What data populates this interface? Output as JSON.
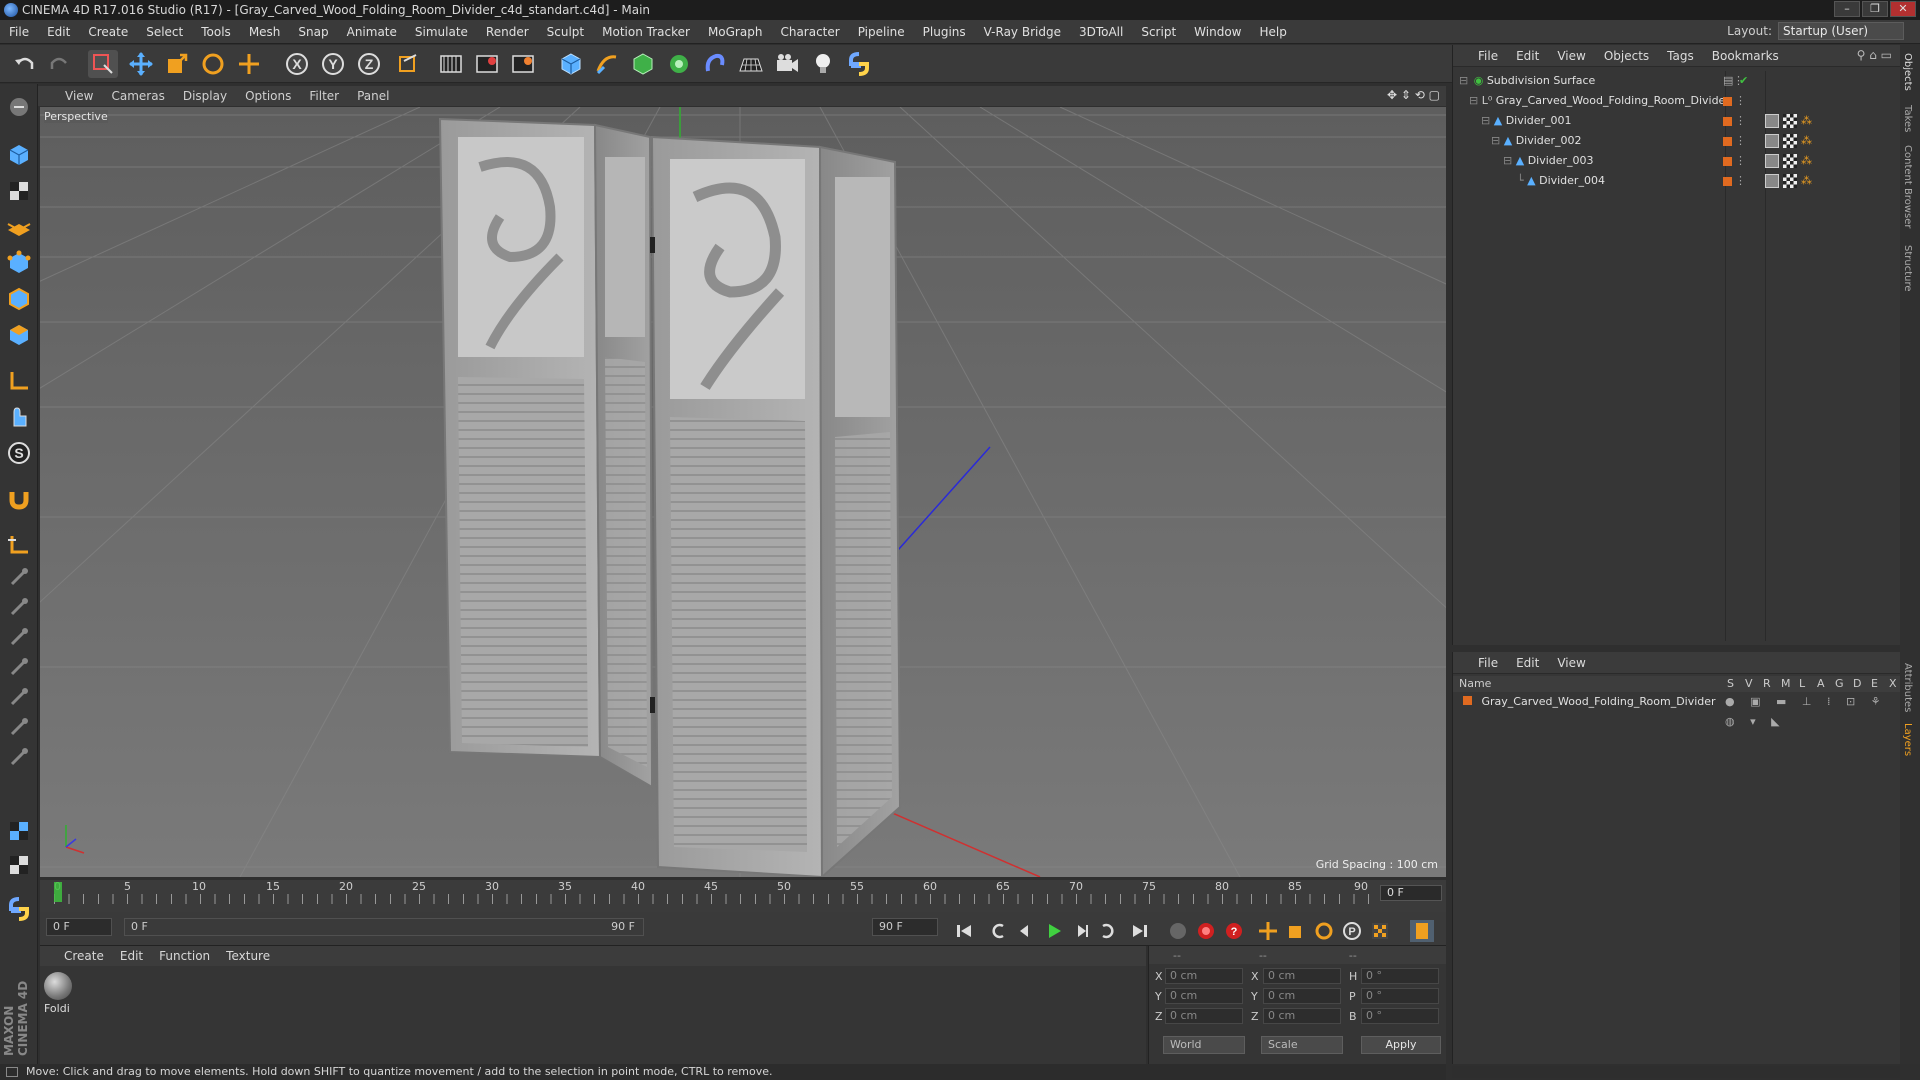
{
  "window": {
    "title": "CINEMA 4D R17.016 Studio (R17) - [Gray_Carved_Wood_Folding_Room_Divider_c4d_standart.c4d] - Main"
  },
  "menu": [
    "File",
    "Edit",
    "Create",
    "Select",
    "Tools",
    "Mesh",
    "Snap",
    "Animate",
    "Simulate",
    "Render",
    "Sculpt",
    "Motion Tracker",
    "MoGraph",
    "Character",
    "Pipeline",
    "Plugins",
    "V-Ray Bridge",
    "3DToAll",
    "Script",
    "Window",
    "Help"
  ],
  "layout": {
    "label": "Layout:",
    "value": "Startup (User)"
  },
  "viewport": {
    "menu": [
      "View",
      "Cameras",
      "Display",
      "Options",
      "Filter",
      "Panel"
    ],
    "camera_label": "Perspective",
    "grid_spacing": "Grid Spacing : 100 cm"
  },
  "timeline": {
    "ticks": [
      "0",
      "5",
      "10",
      "15",
      "20",
      "25",
      "30",
      "35",
      "40",
      "45",
      "50",
      "55",
      "60",
      "65",
      "70",
      "75",
      "80",
      "85",
      "90"
    ],
    "current_frame": "0 F"
  },
  "transport": {
    "start_frame": "0 F",
    "range_start": "0 F",
    "range_end": "90 F",
    "end_frame": "90 F"
  },
  "material": {
    "menu": [
      "Create",
      "Edit",
      "Function",
      "Texture"
    ],
    "items": [
      {
        "name": "Foldi"
      }
    ]
  },
  "coords": {
    "header": [
      "--",
      "--",
      "--"
    ],
    "rows": [
      {
        "axis": "X",
        "pos": "0 cm",
        "axis2": "X",
        "size": "0 cm",
        "rot_label": "H",
        "rot": "0 °"
      },
      {
        "axis": "Y",
        "pos": "0 cm",
        "axis2": "Y",
        "size": "0 cm",
        "rot_label": "P",
        "rot": "0 °"
      },
      {
        "axis": "Z",
        "pos": "0 cm",
        "axis2": "Z",
        "size": "0 cm",
        "rot_label": "B",
        "rot": "0 °"
      }
    ],
    "space": "World",
    "mode": "Scale",
    "apply": "Apply"
  },
  "status": "Move: Click and drag to move elements. Hold down SHIFT to quantize movement / add to the selection in point mode, CTRL to remove.",
  "objects": {
    "menu": [
      "File",
      "Edit",
      "View",
      "Objects",
      "Tags",
      "Bookmarks"
    ],
    "tree": [
      {
        "name": "Subdivision Surface",
        "level": 0
      },
      {
        "name": "Gray_Carved_Wood_Folding_Room_Divider",
        "level": 1
      },
      {
        "name": "Divider_001",
        "level": 2
      },
      {
        "name": "Divider_002",
        "level": 3
      },
      {
        "name": "Divider_003",
        "level": 4
      },
      {
        "name": "Divider_004",
        "level": 5
      }
    ]
  },
  "layers": {
    "menu": [
      "File",
      "Edit",
      "View"
    ],
    "header_name": "Name",
    "header_cols": [
      "S",
      "V",
      "R",
      "M",
      "L",
      "A",
      "G",
      "D",
      "E",
      "X"
    ],
    "rows": [
      {
        "name": "Gray_Carved_Wood_Folding_Room_Divider"
      }
    ]
  },
  "side_tabs": [
    "Objects",
    "Takes",
    "Content Browser",
    "Structure",
    "Attributes",
    "Layers"
  ]
}
